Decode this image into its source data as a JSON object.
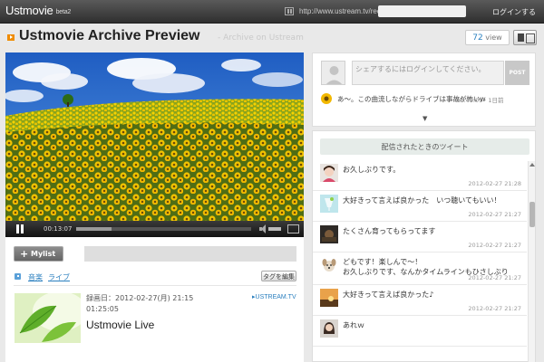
{
  "topbar": {
    "logo": "Ustmovie",
    "logo_badge": "beta2",
    "url_prefix": "http://www.ustream.tv/recorded/",
    "login": "ログインする"
  },
  "page": {
    "title": "Ustmovie Archive Preview",
    "subtitle": "- Archive on Ustream",
    "view_count": "72",
    "view_label": "view"
  },
  "player": {
    "elapsed": "00:13:07",
    "progress": 0.2
  },
  "actions": {
    "mylist_label": "Mylist",
    "edit_tags_label": "タグを編集"
  },
  "tags": [
    "音楽",
    "ライブ"
  ],
  "video_info": {
    "recorded": "録画日：2012-02-27(月) 21:15",
    "duration": "01:25:05",
    "source_link": "▸USTREAM.TV",
    "title": "Ustmovie Live"
  },
  "share": {
    "placeholder": "シェアするにはログインしてください。",
    "post_label": "POST",
    "note_text": "あ～。この曲流しながらドライブは事故が怖いw",
    "note_time": "00:41:01 · 1日前",
    "more_icon": "▼"
  },
  "tweets": {
    "header": "配信されたときのツイート",
    "items": [
      {
        "text": "お久しぶりです。",
        "time": "2012-02-27 21:28",
        "avatar": "girl-avatar"
      },
      {
        "text": "大好きって言えば良かった　いつ聴いてもいい！",
        "time": "2012-02-27 21:27",
        "avatar": "drink-avatar"
      },
      {
        "text": "たくさん育ってもらってます",
        "time": "2012-02-27 21:27",
        "avatar": "dark-avatar"
      },
      {
        "text": "どもです！楽しんで～！\nお久しぶりです、なんかタイムラインもひさしぶり",
        "time": "2012-02-27 21:27",
        "avatar": "dog-avatar"
      },
      {
        "text": "大好きって言えば良かった♪",
        "time": "2012-02-27 21:27",
        "avatar": "sunset-avatar"
      },
      {
        "text": "あれｗ",
        "time": "",
        "avatar": "woman-avatar"
      }
    ]
  }
}
